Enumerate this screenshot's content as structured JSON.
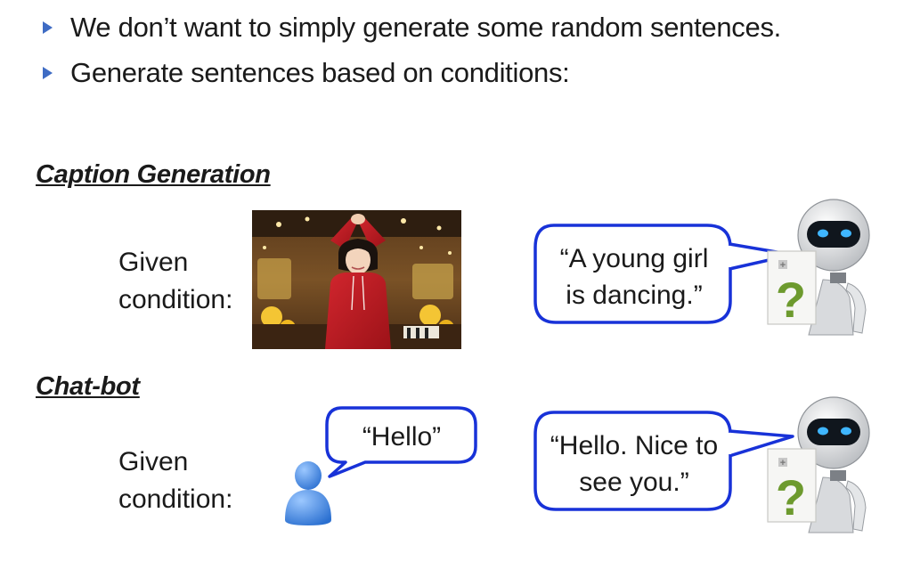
{
  "bullets": [
    "We don’t want to simply generate some random sentences.",
    "Generate sentences based on conditions:"
  ],
  "caption_section": {
    "heading": "Caption Generation",
    "condition_label_line1": "Given",
    "condition_label_line2": "condition:",
    "robot_reply_line1": "“A young girl",
    "robot_reply_line2": "is dancing.”"
  },
  "chatbot_section": {
    "heading": "Chat-bot",
    "condition_label_line1": "Given",
    "condition_label_line2": "condition:",
    "user_message": "“Hello”",
    "robot_reply_line1": "“Hello. Nice to",
    "robot_reply_line2": "see you.”"
  },
  "robot_card_glyph": "?",
  "robot_card_plus": "+",
  "colors": {
    "bullet_accent": "#3f6cc4",
    "bubble_border": "#1832d8",
    "card_question": "#6d9a2e",
    "robot_eye": "#3fb6ff",
    "user_icon": "#3a86e0"
  }
}
